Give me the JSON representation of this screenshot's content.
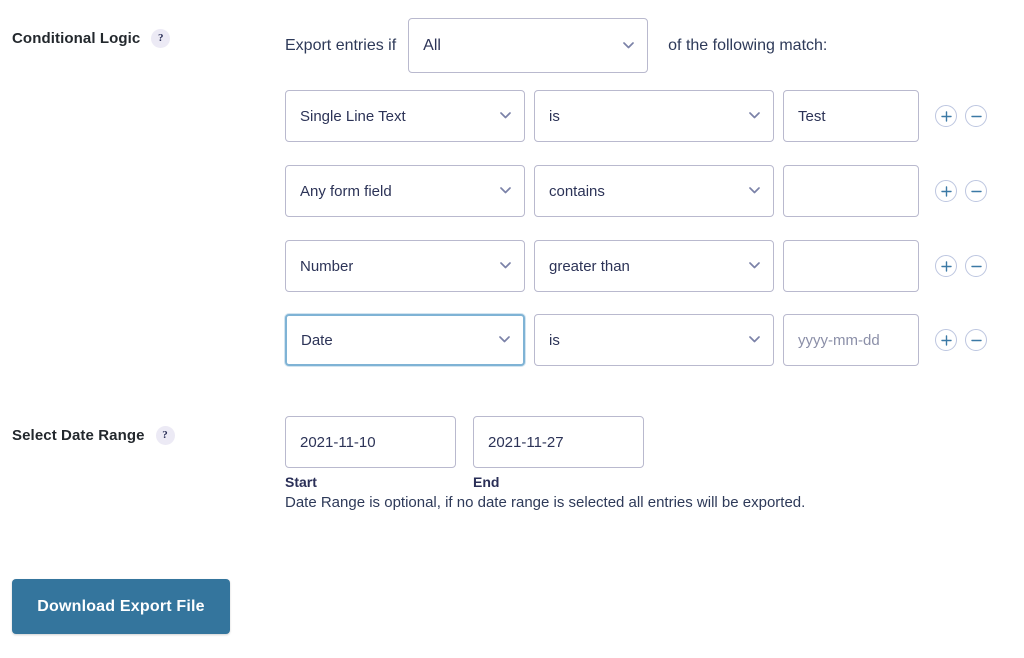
{
  "conditional_logic": {
    "label": "Conditional Logic",
    "help_icon": "question-mark-icon",
    "help_glyph": "?",
    "phrase_before": "Export entries if",
    "phrase_after": "of the following match:",
    "match_type": "All",
    "rows": [
      {
        "field": "Single Line Text",
        "operator": "is",
        "value": "Test",
        "value_placeholder": "",
        "focused": false,
        "add_label": "+",
        "remove_label": "−"
      },
      {
        "field": "Any form field",
        "operator": "contains",
        "value": "",
        "value_placeholder": "",
        "focused": false,
        "add_label": "+",
        "remove_label": "−"
      },
      {
        "field": "Number",
        "operator": "greater than",
        "value": "",
        "value_placeholder": "",
        "focused": false,
        "add_label": "+",
        "remove_label": "−"
      },
      {
        "field": "Date",
        "operator": "is",
        "value": "",
        "value_placeholder": "yyyy-mm-dd",
        "focused": true,
        "add_label": "+",
        "remove_label": "−"
      }
    ]
  },
  "date_range": {
    "label": "Select Date Range",
    "help_glyph": "?",
    "start_value": "2021-11-10",
    "start_caption": "Start",
    "end_value": "2021-11-27",
    "end_caption": "End",
    "note": "Date Range is optional, if no date range is selected all entries will be exported."
  },
  "actions": {
    "download_label": "Download Export File"
  },
  "colors": {
    "accent_button": "#34759d",
    "focus_border": "#7fb3d5",
    "control_border": "#b9b9ce",
    "text": "#2c3357",
    "help_badge_bg": "#eceaf5"
  }
}
